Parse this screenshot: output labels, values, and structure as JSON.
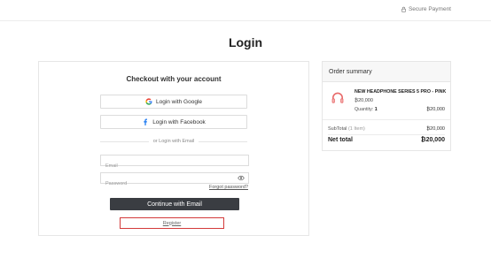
{
  "header": {
    "secure_label": "Secure Payment"
  },
  "page": {
    "title": "Login"
  },
  "login": {
    "heading": "Checkout with your account",
    "google_label": "Login with Google",
    "facebook_label": "Login with Facebook",
    "divider": "or Login with Email",
    "email_placeholder": "Email",
    "password_placeholder": "Password",
    "forgot": "Forgot password?",
    "continue_label": "Continue with Email",
    "register_label": "Register"
  },
  "summary": {
    "title": "Order summary",
    "item": {
      "name": "NEW HEADPHONE SERIES 5 PRO - PINK",
      "price": "₿20,000",
      "qty_label": "Quantity:",
      "qty": "1",
      "total": "₿20,000"
    },
    "subtotal_label": "SubTotal",
    "subtotal_count": "(1 Item)",
    "subtotal_value": "₿20,000",
    "net_label": "Net total",
    "net_value": "₿20,000"
  },
  "colors": {
    "primary_button": "#3a3d42",
    "register_border": "#d33a3a",
    "product_accent": "#e86a6a"
  },
  "icons": {
    "secure": "lock-icon",
    "google": "google-icon",
    "facebook": "facebook-icon",
    "password_toggle": "eye-icon",
    "product": "headphone-icon"
  }
}
